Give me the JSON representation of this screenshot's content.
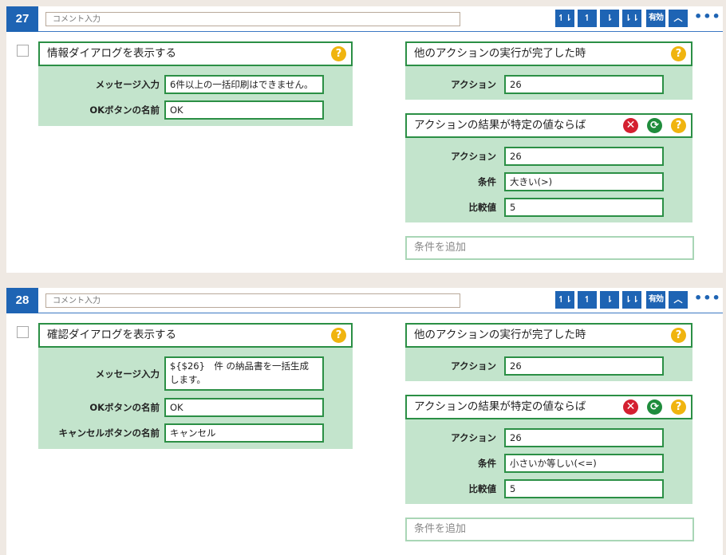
{
  "toolbar": {
    "move_top": "↿⇂",
    "move_up": "↿",
    "move_down": "⇂",
    "move_bottom": "⇂⇂",
    "enabled_label": "有効",
    "collapse": "︿",
    "more": "•••"
  },
  "colors": {
    "header_blue": "#1e64b4",
    "block_green_border": "#2b8f45",
    "block_green_fill": "#c3e4cc",
    "help_yellow": "#f0b40f",
    "delete_red": "#d42030"
  },
  "steps": [
    {
      "number": "27",
      "comment_placeholder": "コメント入力",
      "action": {
        "title": "情報ダイアログを表示する",
        "fields": [
          {
            "label": "メッセージ入力",
            "value": "6件以上の一括印刷はできません。"
          },
          {
            "label": "OKボタンの名前",
            "value": "OK"
          }
        ]
      },
      "trigger": {
        "title": "他のアクションの実行が完了した時",
        "fields": [
          {
            "label": "アクション",
            "value": "26"
          }
        ]
      },
      "condition": {
        "title": "アクションの結果が特定の値ならば",
        "fields": [
          {
            "label": "アクション",
            "value": "26"
          },
          {
            "label": "条件",
            "value": "大きい(>)"
          },
          {
            "label": "比較値",
            "value": "5"
          }
        ]
      },
      "add_condition": "条件を追加"
    },
    {
      "number": "28",
      "comment_placeholder": "コメント入力",
      "action": {
        "title": "確認ダイアログを表示する",
        "fields": [
          {
            "label": "メッセージ入力",
            "value": "${$26}　件 の納品書を一括生成します。"
          },
          {
            "label": "OKボタンの名前",
            "value": "OK"
          },
          {
            "label": "キャンセルボタンの名前",
            "value": "キャンセル"
          }
        ]
      },
      "trigger": {
        "title": "他のアクションの実行が完了した時",
        "fields": [
          {
            "label": "アクション",
            "value": "26"
          }
        ]
      },
      "condition": {
        "title": "アクションの結果が特定の値ならば",
        "fields": [
          {
            "label": "アクション",
            "value": "26"
          },
          {
            "label": "条件",
            "value": "小さいか等しい(<=)"
          },
          {
            "label": "比較値",
            "value": "5"
          }
        ]
      },
      "add_condition": "条件を追加"
    }
  ]
}
